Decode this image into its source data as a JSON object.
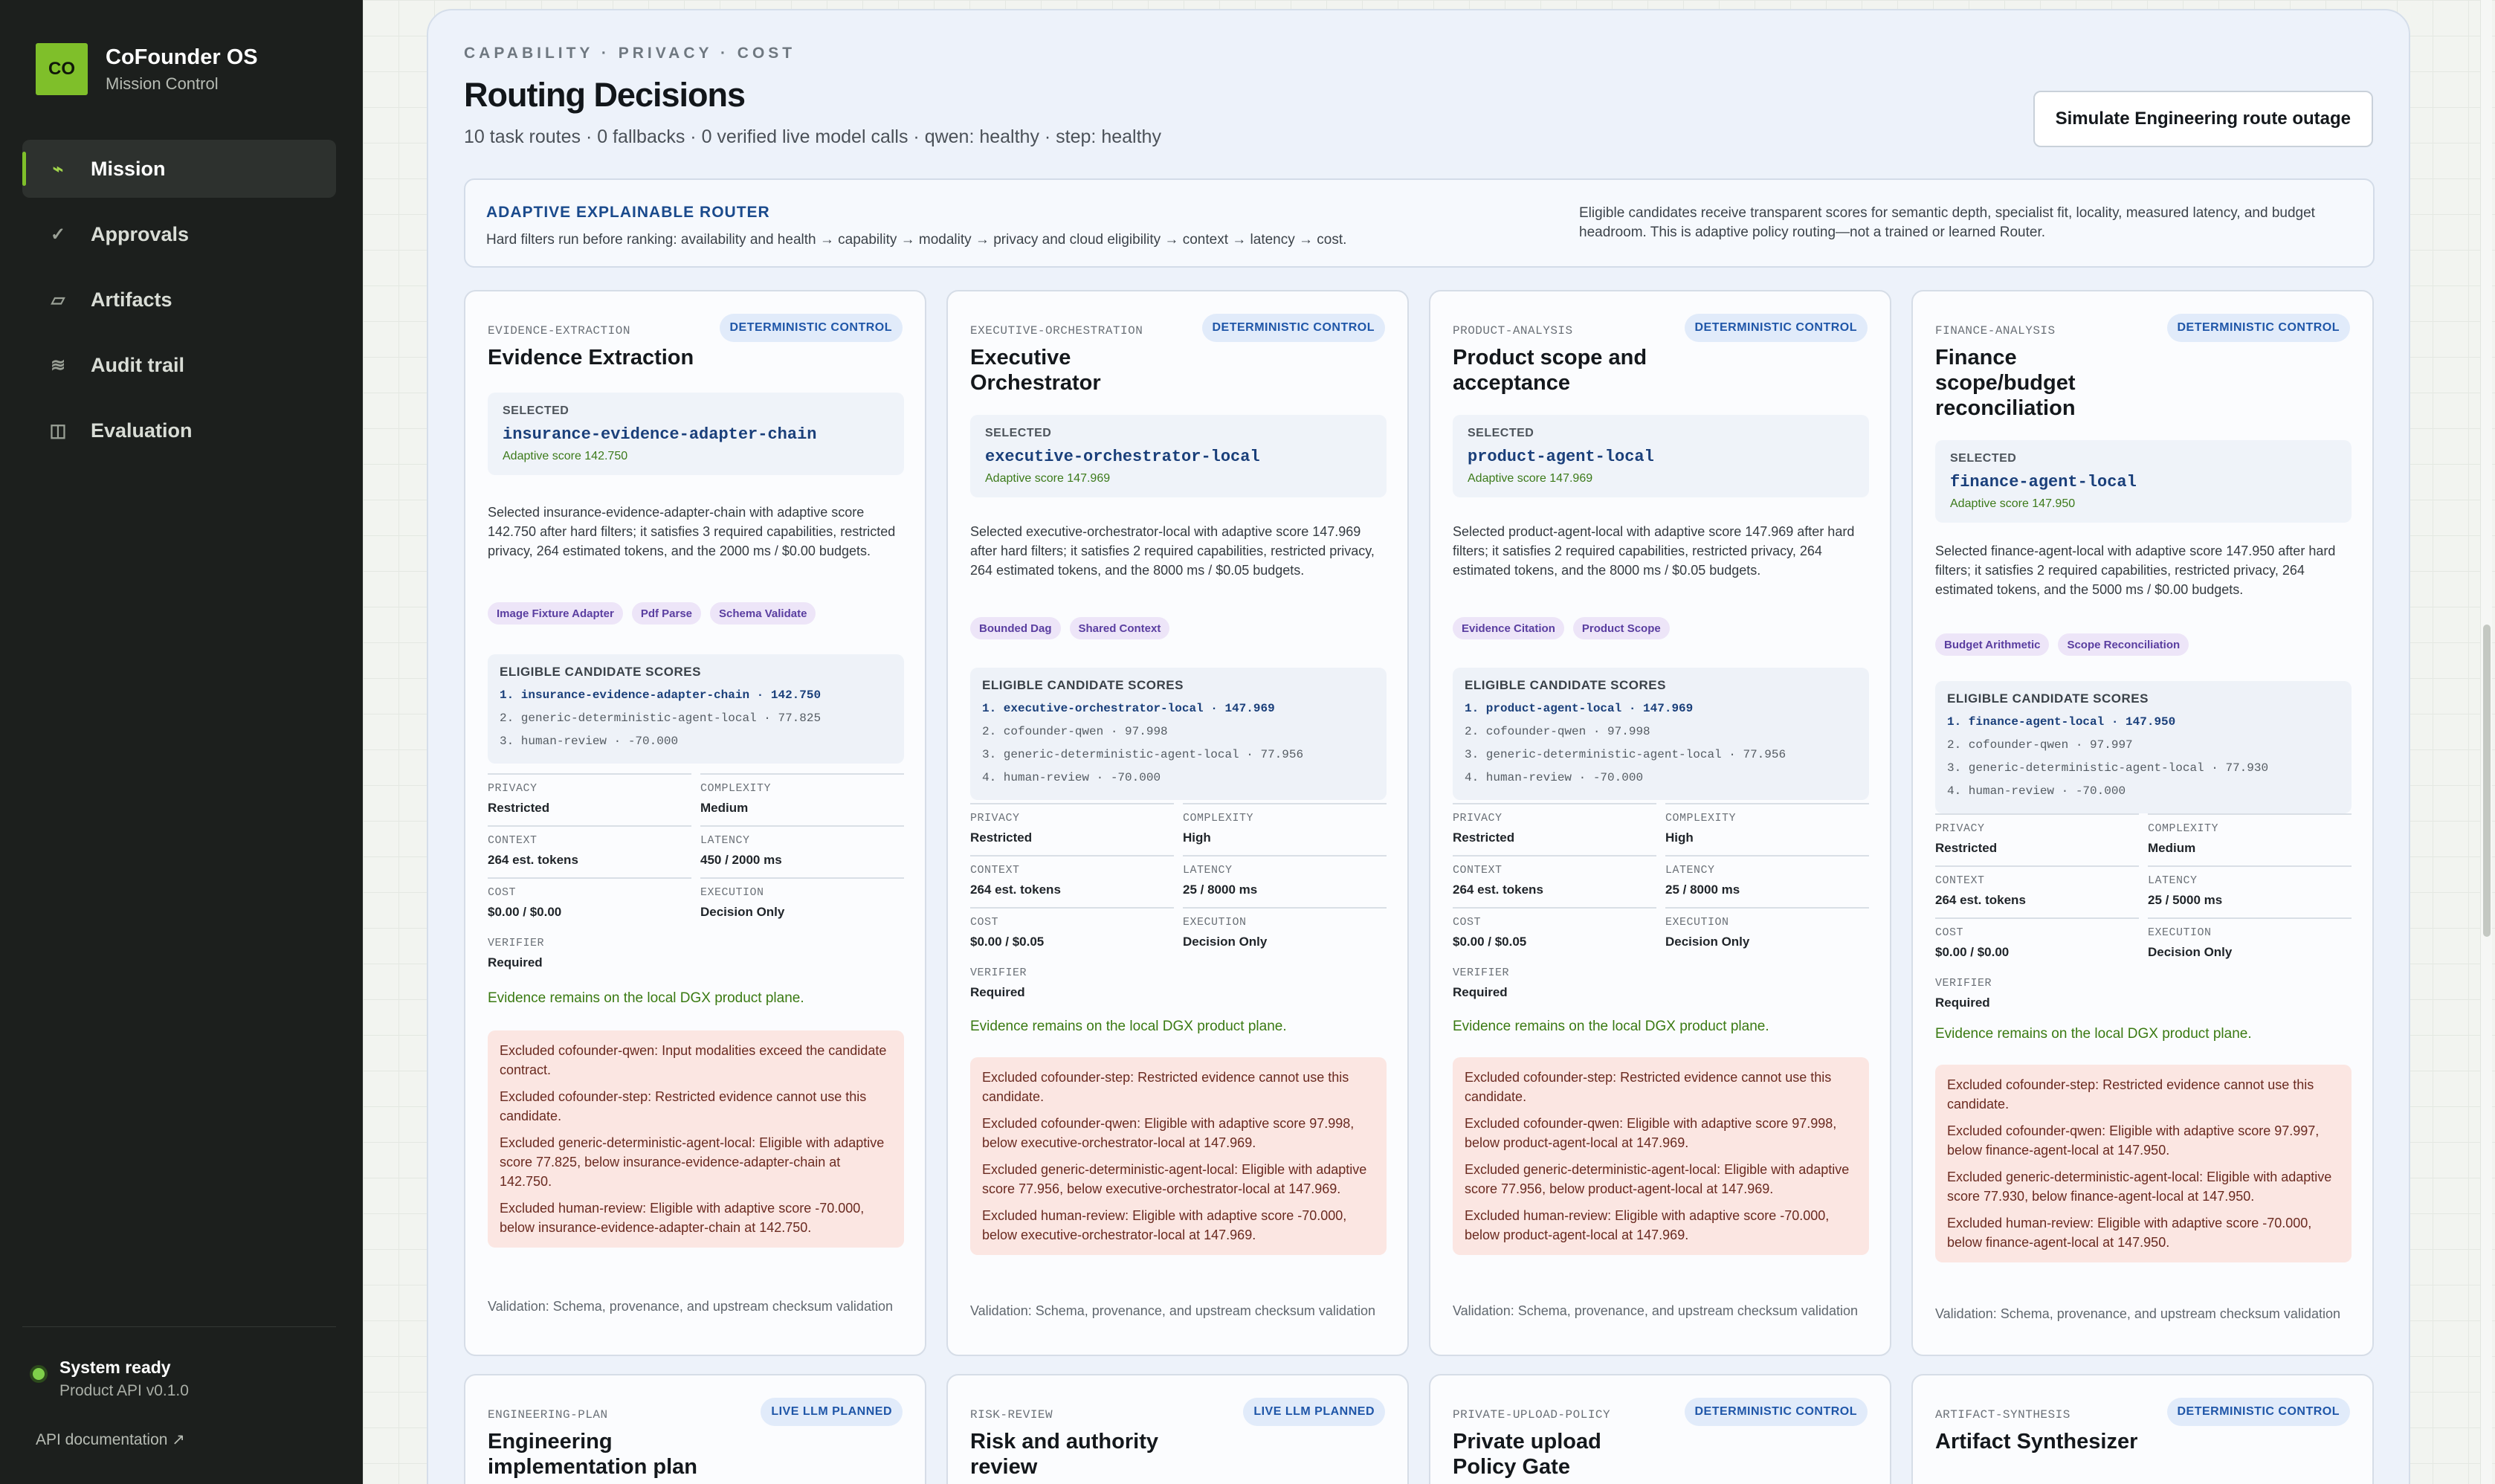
{
  "brand": {
    "logo": "CO",
    "title": "CoFounder OS",
    "subtitle": "Mission Control"
  },
  "nav": [
    {
      "label": "Mission",
      "icon": "pulse-icon",
      "glyph": "⌁",
      "active": true
    },
    {
      "label": "Approvals",
      "icon": "check-icon",
      "glyph": "✓",
      "active": false
    },
    {
      "label": "Artifacts",
      "icon": "artifact-icon",
      "glyph": "▱",
      "active": false
    },
    {
      "label": "Audit trail",
      "icon": "audit-icon",
      "glyph": "≋",
      "active": false
    },
    {
      "label": "Evaluation",
      "icon": "evaluation-icon",
      "glyph": "◫",
      "active": false
    }
  ],
  "status": {
    "title": "System ready",
    "subtitle": "Product API v0.1.0"
  },
  "api_doc": "API documentation ↗",
  "header": {
    "eyebrow": "CAPABILITY · PRIVACY · COST",
    "title": "Routing Decisions",
    "subtitle": "10 task routes · 0 fallbacks · 0 verified live model calls · qwen: healthy · step: healthy",
    "simulate_button": "Simulate Engineering route outage"
  },
  "adaptive": {
    "title": "ADAPTIVE EXPLAINABLE ROUTER",
    "text": "Hard filters run before ranking: availability and health → capability → modality → privacy and cloud eligibility → context → latency → cost.",
    "right": "Eligible candidates receive transparent scores for semantic depth, specialist fit, locality, measured latency, and budget headroom. This is adaptive policy routing—not a trained or learned Router."
  },
  "labels": {
    "selected": "SELECTED",
    "eligible": "ELIGIBLE CANDIDATE SCORES",
    "privacy": "PRIVACY",
    "complexity": "COMPLEXITY",
    "context": "CONTEXT",
    "latency": "LATENCY",
    "cost": "COST",
    "execution": "EXECUTION",
    "verifier": "VERIFIER"
  },
  "cards": [
    {
      "task_id": "EVIDENCE-EXTRACTION",
      "badge": "DETERMINISTIC CONTROL",
      "title": "Evidence Extraction",
      "selected": "insurance-evidence-adapter-chain",
      "score": "Adaptive score 142.750",
      "description": "Selected insurance-evidence-adapter-chain with adaptive score 142.750 after hard filters; it satisfies 3 required capabilities, restricted privacy, 264 estimated tokens, and the 2000 ms / $0.00 budgets.",
      "chips": [
        "Image Fixture Adapter",
        "Pdf Parse",
        "Schema Validate"
      ],
      "eligible": [
        "1. insurance-evidence-adapter-chain · 142.750",
        "2. generic-deterministic-agent-local · 77.825",
        "3. human-review · -70.000"
      ],
      "privacy": "Restricted",
      "complexity": "Medium",
      "context": "264 est. tokens",
      "latency": "450 / 2000 ms",
      "cost": "$0.00 / $0.00",
      "execution": "Decision Only",
      "verifier": "Required",
      "note": "Evidence remains on the local DGX product plane.",
      "excluded": [
        "Excluded cofounder-qwen: Input modalities exceed the candidate contract.",
        "Excluded cofounder-step: Restricted evidence cannot use this candidate.",
        "Excluded generic-deterministic-agent-local: Eligible with adaptive score 77.825, below insurance-evidence-adapter-chain at 142.750.",
        "Excluded human-review: Eligible with adaptive score -70.000, below insurance-evidence-adapter-chain at 142.750."
      ],
      "validation": "Validation: Schema, provenance, and upstream checksum validation"
    },
    {
      "task_id": "EXECUTIVE-ORCHESTRATION",
      "badge": "DETERMINISTIC CONTROL",
      "title": "Executive Orchestrator",
      "selected": "executive-orchestrator-local",
      "score": "Adaptive score 147.969",
      "description": "Selected executive-orchestrator-local with adaptive score 147.969 after hard filters; it satisfies 2 required capabilities, restricted privacy, 264 estimated tokens, and the 8000 ms / $0.05 budgets.",
      "chips": [
        "Bounded Dag",
        "Shared Context"
      ],
      "eligible": [
        "1. executive-orchestrator-local · 147.969",
        "2. cofounder-qwen · 97.998",
        "3. generic-deterministic-agent-local · 77.956",
        "4. human-review · -70.000"
      ],
      "privacy": "Restricted",
      "complexity": "High",
      "context": "264 est. tokens",
      "latency": "25 / 8000 ms",
      "cost": "$0.00 / $0.05",
      "execution": "Decision Only",
      "verifier": "Required",
      "note": "Evidence remains on the local DGX product plane.",
      "excluded": [
        "Excluded cofounder-step: Restricted evidence cannot use this candidate.",
        "Excluded cofounder-qwen: Eligible with adaptive score 97.998, below executive-orchestrator-local at 147.969.",
        "Excluded generic-deterministic-agent-local: Eligible with adaptive score 77.956, below executive-orchestrator-local at 147.969.",
        "Excluded human-review: Eligible with adaptive score -70.000, below executive-orchestrator-local at 147.969."
      ],
      "validation": "Validation: Schema, provenance, and upstream checksum validation"
    },
    {
      "task_id": "PRODUCT-ANALYSIS",
      "badge": "DETERMINISTIC CONTROL",
      "title": "Product scope and acceptance",
      "selected": "product-agent-local",
      "score": "Adaptive score 147.969",
      "description": "Selected product-agent-local with adaptive score 147.969 after hard filters; it satisfies 2 required capabilities, restricted privacy, 264 estimated tokens, and the 8000 ms / $0.05 budgets.",
      "chips": [
        "Evidence Citation",
        "Product Scope"
      ],
      "eligible": [
        "1. product-agent-local · 147.969",
        "2. cofounder-qwen · 97.998",
        "3. generic-deterministic-agent-local · 77.956",
        "4. human-review · -70.000"
      ],
      "privacy": "Restricted",
      "complexity": "High",
      "context": "264 est. tokens",
      "latency": "25 / 8000 ms",
      "cost": "$0.00 / $0.05",
      "execution": "Decision Only",
      "verifier": "Required",
      "note": "Evidence remains on the local DGX product plane.",
      "excluded": [
        "Excluded cofounder-step: Restricted evidence cannot use this candidate.",
        "Excluded cofounder-qwen: Eligible with adaptive score 97.998, below product-agent-local at 147.969.",
        "Excluded generic-deterministic-agent-local: Eligible with adaptive score 77.956, below product-agent-local at 147.969.",
        "Excluded human-review: Eligible with adaptive score -70.000, below product-agent-local at 147.969."
      ],
      "validation": "Validation: Schema, provenance, and upstream checksum validation"
    },
    {
      "task_id": "FINANCE-ANALYSIS",
      "badge": "DETERMINISTIC CONTROL",
      "title": "Finance scope/budget reconciliation",
      "selected": "finance-agent-local",
      "score": "Adaptive score 147.950",
      "description": "Selected finance-agent-local with adaptive score 147.950 after hard filters; it satisfies 2 required capabilities, restricted privacy, 264 estimated tokens, and the 5000 ms / $0.00 budgets.",
      "chips": [
        "Budget Arithmetic",
        "Scope Reconciliation"
      ],
      "eligible": [
        "1. finance-agent-local · 147.950",
        "2. cofounder-qwen · 97.997",
        "3. generic-deterministic-agent-local · 77.930",
        "4. human-review · -70.000"
      ],
      "privacy": "Restricted",
      "complexity": "Medium",
      "context": "264 est. tokens",
      "latency": "25 / 5000 ms",
      "cost": "$0.00 / $0.00",
      "execution": "Decision Only",
      "verifier": "Required",
      "note": "Evidence remains on the local DGX product plane.",
      "excluded": [
        "Excluded cofounder-step: Restricted evidence cannot use this candidate.",
        "Excluded cofounder-qwen: Eligible with adaptive score 97.997, below finance-agent-local at 147.950.",
        "Excluded generic-deterministic-agent-local: Eligible with adaptive score 77.930, below finance-agent-local at 147.950.",
        "Excluded human-review: Eligible with adaptive score -70.000, below finance-agent-local at 147.950."
      ],
      "validation": "Validation: Schema, provenance, and upstream checksum validation"
    }
  ],
  "lower_cards": [
    {
      "task_id": "ENGINEERING-PLAN",
      "badge": "LIVE LLM PLANNED",
      "title": "Engineering implementation plan"
    },
    {
      "task_id": "RISK-REVIEW",
      "badge": "LIVE LLM PLANNED",
      "title": "Risk and authority review"
    },
    {
      "task_id": "PRIVATE-UPLOAD-POLICY",
      "badge": "DETERMINISTIC CONTROL",
      "title": "Private upload Policy Gate"
    },
    {
      "task_id": "ARTIFACT-SYNTHESIS",
      "badge": "DETERMINISTIC CONTROL",
      "title": "Artifact Synthesizer"
    }
  ]
}
